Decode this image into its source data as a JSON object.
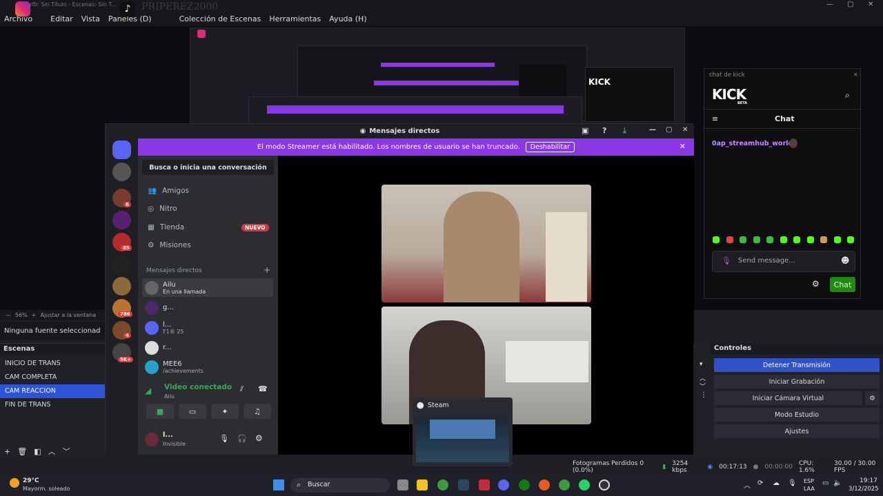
{
  "obs": {
    "title": "Perfil: Sin Título - Escenas: Sin T...",
    "watermark": "PRIPEREZ2000",
    "menu": [
      "Archivo",
      "Editar",
      "Vista",
      "Paneles (D)",
      "Colección de Escenas",
      "Herramientas",
      "Ayuda (H)"
    ],
    "zoom": "56%",
    "fit_label": "Ajustar a la ventana",
    "source_status": "Ninguna fuente seleccionad",
    "scenes_title": "Escenas",
    "scenes": [
      "INICIO DE TRANS",
      "CAM COMPLETA",
      "CAM REACCION",
      "FIN DE TRANS"
    ],
    "selected_scene_index": 2,
    "controls_title": "Controles",
    "controls": [
      "Detener Transmisión",
      "Iniciar Grabación",
      "Iniciar Cámara Virtual",
      "Modo Estudio",
      "Ajustes"
    ],
    "status": {
      "dropped": "Fotogramas Perdidos 0 (0.0%)",
      "bitrate": "3254 kbps",
      "live_time": "00:17:13",
      "rec_time": "00:00:00",
      "cpu": "CPU: 1.6%",
      "fps": "30.00 / 30.00 FPS"
    }
  },
  "discord": {
    "title": "Mensajes directos",
    "banner_text": "El modo Streamer está habilitado. Los nombres de usuario se han truncado.",
    "banner_button": "Deshabilitar",
    "search_label": "Busca o inicia una conversación",
    "nav": [
      "Amigos",
      "Nitro",
      "Tienda",
      "Misiones"
    ],
    "new_badge": "NUEVO",
    "dm_header": "Mensajes directos",
    "dms": [
      {
        "name": "Ailu",
        "sub": "En una llamada"
      },
      {
        "name": "g...",
        "sub": ""
      },
      {
        "name": "l...",
        "sub": "F1® 25"
      },
      {
        "name": "r...",
        "sub": ""
      },
      {
        "name": "MEE6",
        "sub": "/achievements"
      }
    ],
    "server_badges": [
      "6",
      "85",
      "786",
      "4",
      "9K+"
    ],
    "voice_status": "Video conectado",
    "voice_user": "Ailu",
    "user_name": "l...",
    "user_status": "Invisible"
  },
  "kick": {
    "window_title": "chat de kick",
    "logo": "KICK",
    "beta": "BETA",
    "chat_title": "Chat",
    "message_user": "0ap_streamhub_world:",
    "input_placeholder": "Send message...",
    "chat_button": "Chat"
  },
  "steam_popup": "Steam",
  "taskbar": {
    "temp": "29°C",
    "weather": "Mayorm. soleado",
    "search": "Buscar",
    "lang1": "ESP",
    "lang2": "LAA",
    "time": "19:17",
    "date": "3/12/2025"
  },
  "colors": {
    "accent": "#2f52c8",
    "discord_banner": "#8b37e8",
    "kick_green": "#53fc18"
  }
}
